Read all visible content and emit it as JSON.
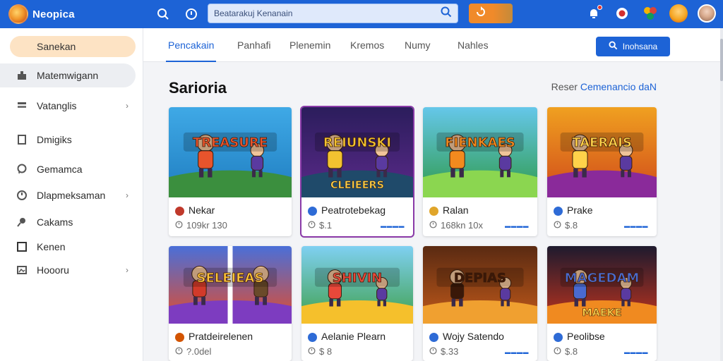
{
  "app": {
    "name": "Neopica"
  },
  "header": {
    "search_placeholder": "Beatarakuj Kenanain",
    "icons": [
      "search-icon",
      "clock-icon",
      "notification-icon",
      "record-icon",
      "games-icon",
      "avatar-orange",
      "avatar-user"
    ]
  },
  "sidebar": {
    "top_item": "Sanekan",
    "items": [
      {
        "label": "Matemwigann",
        "icon": "building-icon",
        "active": true,
        "chevron": false
      },
      {
        "label": "Vatanglis",
        "icon": "stack-icon",
        "active": false,
        "chevron": true
      },
      {
        "label": "Dmigiks",
        "icon": "file-icon",
        "active": false,
        "chevron": false
      },
      {
        "label": "Gemamca",
        "icon": "chat-icon",
        "active": false,
        "chevron": false
      },
      {
        "label": "Dlapmeksaman",
        "icon": "history-icon",
        "active": false,
        "chevron": true
      },
      {
        "label": "Cakams",
        "icon": "pin-icon",
        "active": false,
        "chevron": false
      },
      {
        "label": "Kenen",
        "icon": "square-icon",
        "active": false,
        "chevron": false
      },
      {
        "label": "Hoooru",
        "icon": "image-icon",
        "active": false,
        "chevron": true
      }
    ]
  },
  "tabs": [
    "Pencakain",
    "Panhafi",
    "Plenemin",
    "Kremos",
    "Numy",
    "Nahles"
  ],
  "actions": {
    "primary_button": "Inohsana"
  },
  "section": {
    "title": "Sarioria",
    "link_prefix": "Reser",
    "link_text": "Cemenancio daN"
  },
  "cards": [
    {
      "title": "Nekar",
      "meta": "109kr 130",
      "tag": "",
      "icon_color": "#c0392b",
      "art": "adventure",
      "art_text": "TREASURE"
    },
    {
      "title": "Peatrotebekag",
      "meta": "$.1",
      "tag": "▬▬▬▬",
      "icon_color": "#2e6bd6",
      "art": "ninja",
      "art_text": "REIUNSKI",
      "art_text2": "CLEIEERS"
    },
    {
      "title": "Ralan",
      "meta": "168kn 10x",
      "tag": "▬▬▬▬",
      "icon_color": "#e0a52a",
      "art": "jungle",
      "art_text": "FIENKAES"
    },
    {
      "title": "Prake",
      "meta": "$.8",
      "tag": "▬▬▬▬",
      "icon_color": "#2e6bd6",
      "art": "cowboy",
      "art_text": "TAERAIS"
    },
    {
      "title": "Pratdeirelenen",
      "meta": "?.0del",
      "tag": "",
      "icon_color": "#d35400",
      "art": "pair",
      "art_text": "SELEIEAS"
    },
    {
      "title": "Aelanie Plearn",
      "meta": "$ 8",
      "tag": "",
      "icon_color": "#2e6bd6",
      "art": "mascot",
      "art_text": "SHIVIN"
    },
    {
      "title": "Wojy Satendo",
      "meta": "$.33",
      "tag": "▬▬▬▬",
      "icon_color": "#2e6bd6",
      "art": "temple",
      "art_text": "DEPIAS"
    },
    {
      "title": "Peolibse",
      "meta": "$.8",
      "tag": "▬▬▬▬",
      "icon_color": "#2e6bd6",
      "art": "shooter",
      "art_text": "MAGEDAM",
      "art_text2": "MAEKE"
    }
  ]
}
